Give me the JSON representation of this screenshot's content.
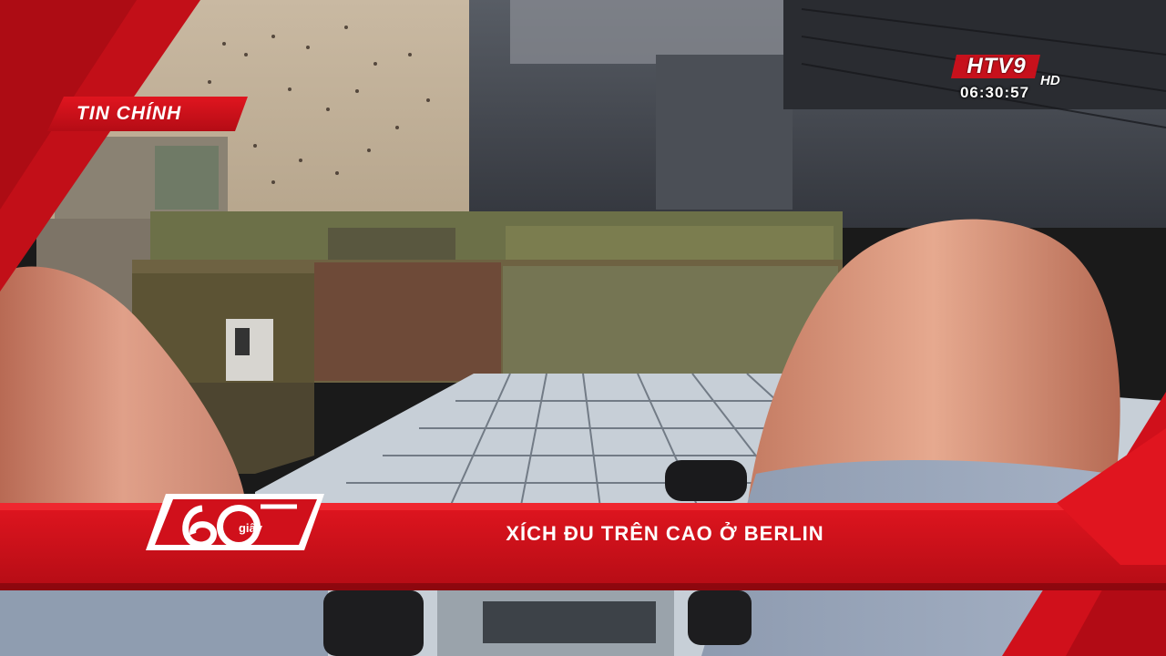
{
  "broadcast": {
    "section_label": "TIN CHÍNH",
    "headline": "XÍCH ĐU TRÊN CAO Ở BERLIN",
    "clock": "06:30:57",
    "channel": {
      "name": "HTV9",
      "quality": "HD"
    },
    "program_logo": {
      "number": "60",
      "unit": "giây"
    }
  },
  "colors": {
    "accent_red": "#d0101b",
    "dark_red": "#9e0a12",
    "white": "#ffffff"
  }
}
